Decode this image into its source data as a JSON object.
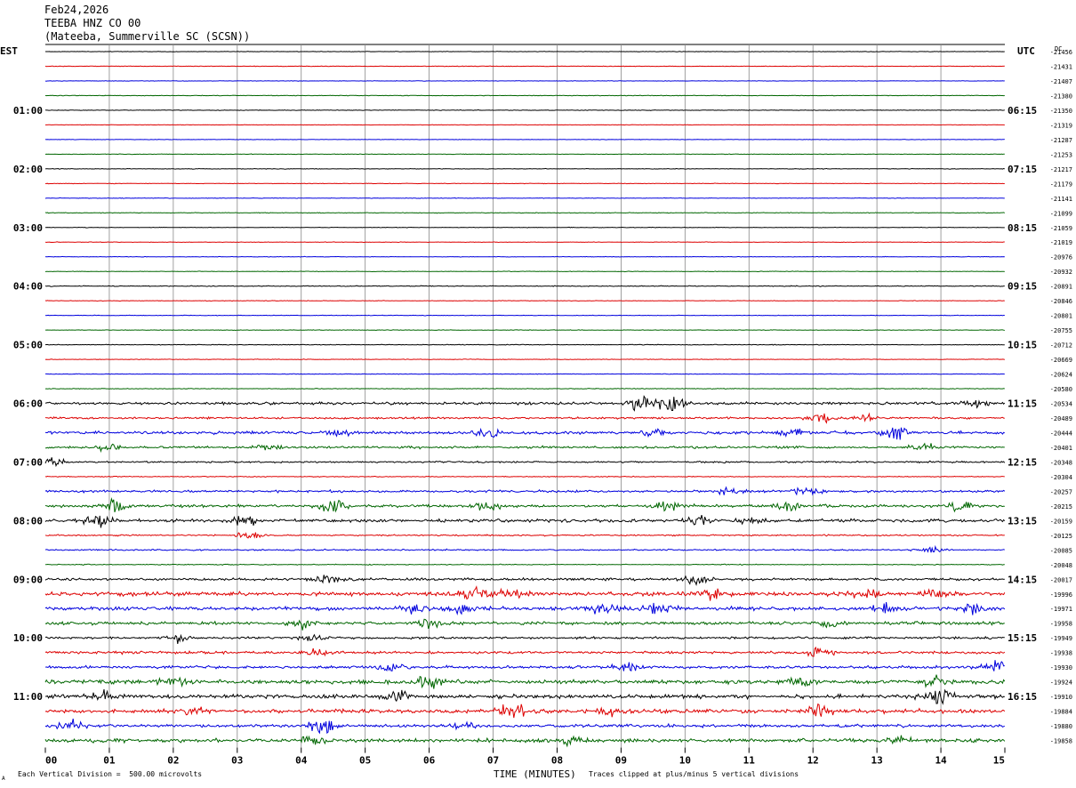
{
  "header": {
    "date": "Feb24,2026",
    "station": "TEEBA HNZ CO 00",
    "location": "(Mateeba, Summerville SC (SCSN))"
  },
  "footer": {
    "scale_note": "Each Vertical Division =  500.00 microvolts",
    "clip_note": "Traces clipped at plus/minus 5 vertical divisions",
    "corner_mark": "A"
  },
  "colors": {
    "cycle": [
      "#000000",
      "#dd0000",
      "#0000dd",
      "#006600"
    ],
    "grid": "#888888"
  },
  "chart_data": {
    "type": "line",
    "subtype": "helicorder",
    "xlabel": "TIME (MINUTES)",
    "x_ticks": [
      "00",
      "01",
      "02",
      "03",
      "04",
      "05",
      "06",
      "07",
      "08",
      "09",
      "10",
      "11",
      "12",
      "13",
      "14",
      "15"
    ],
    "xlim": [
      0,
      15
    ],
    "left_axis_label": "EST",
    "right_axis_label": "UTC",
    "dc_label": "DC",
    "left_hour_labels": [
      "01:00",
      "02:00",
      "03:00",
      "04:00",
      "05:00",
      "06:00",
      "07:00",
      "08:00",
      "09:00",
      "10:00",
      "11:00"
    ],
    "right_hour_labels": [
      "06:15",
      "07:15",
      "08:15",
      "09:15",
      "10:15",
      "11:15",
      "12:15",
      "13:15",
      "14:15",
      "15:15",
      "16:15"
    ],
    "grid": true,
    "rows_per_hour": 4,
    "dc_offsets": [
      -21456,
      -21431,
      -21407,
      -21380,
      -21350,
      -21319,
      -21287,
      -21253,
      -21217,
      -21179,
      -21141,
      -21099,
      -21059,
      -21019,
      -20976,
      -20932,
      -20891,
      -20846,
      -20801,
      -20755,
      -20712,
      -20669,
      -20624,
      -20580,
      -20534,
      -20489,
      -20444,
      -20401,
      -20348,
      -20304,
      -20257,
      -20215,
      -20159,
      -20125,
      -20085,
      -20048,
      -20017,
      -19996,
      -19971,
      -19958,
      -19949,
      -19938,
      -19930,
      -19924,
      -19910,
      -19884,
      -19880,
      -19858
    ],
    "trace_activity": [
      0.15,
      0.2,
      0.15,
      0.2,
      0.2,
      0.15,
      0.15,
      0.2,
      0.2,
      0.2,
      0.2,
      0.25,
      0.2,
      0.2,
      0.2,
      0.2,
      0.3,
      0.2,
      0.2,
      0.2,
      0.25,
      0.2,
      0.2,
      0.25,
      0.9,
      0.7,
      1.0,
      0.8,
      0.6,
      0.3,
      0.8,
      1.0,
      1.1,
      0.5,
      0.5,
      0.3,
      0.9,
      1.4,
      1.3,
      1.1,
      0.8,
      0.9,
      1.0,
      1.4,
      1.4,
      1.4,
      1.0,
      1.3
    ],
    "events": [
      {
        "row": 24,
        "minute": 9.3,
        "amplitude": 2.0
      },
      {
        "row": 24,
        "minute": 9.8,
        "amplitude": 2.6
      },
      {
        "row": 24,
        "minute": 14.5,
        "amplitude": 0.8
      },
      {
        "row": 25,
        "minute": 12.1,
        "amplitude": 1.4
      },
      {
        "row": 25,
        "minute": 12.8,
        "amplitude": 0.8
      },
      {
        "row": 26,
        "minute": 4.6,
        "amplitude": 0.7
      },
      {
        "row": 26,
        "minute": 6.9,
        "amplitude": 1.2
      },
      {
        "row": 26,
        "minute": 9.5,
        "amplitude": 0.9
      },
      {
        "row": 26,
        "minute": 11.7,
        "amplitude": 1.0
      },
      {
        "row": 26,
        "minute": 13.3,
        "amplitude": 1.6
      },
      {
        "row": 27,
        "minute": 1.0,
        "amplitude": 0.8
      },
      {
        "row": 27,
        "minute": 3.5,
        "amplitude": 0.7
      },
      {
        "row": 27,
        "minute": 13.7,
        "amplitude": 1.0
      },
      {
        "row": 28,
        "minute": 0.1,
        "amplitude": 1.0
      },
      {
        "row": 30,
        "minute": 10.7,
        "amplitude": 1.0
      },
      {
        "row": 30,
        "minute": 11.9,
        "amplitude": 1.1
      },
      {
        "row": 31,
        "minute": 1.1,
        "amplitude": 1.6
      },
      {
        "row": 31,
        "minute": 4.5,
        "amplitude": 1.8
      },
      {
        "row": 31,
        "minute": 6.9,
        "amplitude": 1.2
      },
      {
        "row": 31,
        "minute": 9.7,
        "amplitude": 1.4
      },
      {
        "row": 31,
        "minute": 11.6,
        "amplitude": 1.1
      },
      {
        "row": 31,
        "minute": 14.3,
        "amplitude": 1.1
      },
      {
        "row": 32,
        "minute": 0.8,
        "amplitude": 1.6
      },
      {
        "row": 32,
        "minute": 3.1,
        "amplitude": 1.4
      },
      {
        "row": 32,
        "minute": 10.2,
        "amplitude": 1.2
      },
      {
        "row": 32,
        "minute": 11.0,
        "amplitude": 0.8
      },
      {
        "row": 33,
        "minute": 3.2,
        "amplitude": 0.9
      },
      {
        "row": 34,
        "minute": 13.8,
        "amplitude": 0.8
      },
      {
        "row": 36,
        "minute": 4.4,
        "amplitude": 1.1
      },
      {
        "row": 36,
        "minute": 10.2,
        "amplitude": 1.3
      },
      {
        "row": 37,
        "minute": 6.7,
        "amplitude": 2.0
      },
      {
        "row": 37,
        "minute": 7.3,
        "amplitude": 1.1
      },
      {
        "row": 37,
        "minute": 10.4,
        "amplitude": 1.2
      },
      {
        "row": 37,
        "minute": 12.8,
        "amplitude": 1.2
      },
      {
        "row": 37,
        "minute": 13.9,
        "amplitude": 1.5
      },
      {
        "row": 38,
        "minute": 5.8,
        "amplitude": 1.2
      },
      {
        "row": 38,
        "minute": 6.5,
        "amplitude": 1.4
      },
      {
        "row": 38,
        "minute": 8.7,
        "amplitude": 1.4
      },
      {
        "row": 38,
        "minute": 9.6,
        "amplitude": 1.5
      },
      {
        "row": 38,
        "minute": 13.1,
        "amplitude": 1.0
      },
      {
        "row": 38,
        "minute": 14.5,
        "amplitude": 1.0
      },
      {
        "row": 39,
        "minute": 4.0,
        "amplitude": 1.0
      },
      {
        "row": 39,
        "minute": 6.0,
        "amplitude": 1.3
      },
      {
        "row": 39,
        "minute": 12.3,
        "amplitude": 1.0
      },
      {
        "row": 40,
        "minute": 2.1,
        "amplitude": 0.9
      },
      {
        "row": 40,
        "minute": 4.2,
        "amplitude": 0.9
      },
      {
        "row": 41,
        "minute": 4.3,
        "amplitude": 1.0
      },
      {
        "row": 41,
        "minute": 12.1,
        "amplitude": 0.9
      },
      {
        "row": 42,
        "minute": 5.4,
        "amplitude": 0.9
      },
      {
        "row": 42,
        "minute": 9.1,
        "amplitude": 0.8
      },
      {
        "row": 42,
        "minute": 14.9,
        "amplitude": 2.0
      },
      {
        "row": 43,
        "minute": 2.0,
        "amplitude": 1.0
      },
      {
        "row": 43,
        "minute": 6.0,
        "amplitude": 1.2
      },
      {
        "row": 43,
        "minute": 11.8,
        "amplitude": 1.0
      },
      {
        "row": 43,
        "minute": 13.9,
        "amplitude": 1.2
      },
      {
        "row": 44,
        "minute": 0.9,
        "amplitude": 1.0
      },
      {
        "row": 44,
        "minute": 5.5,
        "amplitude": 1.2
      },
      {
        "row": 44,
        "minute": 14.0,
        "amplitude": 1.5
      },
      {
        "row": 45,
        "minute": 2.3,
        "amplitude": 1.2
      },
      {
        "row": 45,
        "minute": 7.3,
        "amplitude": 1.5
      },
      {
        "row": 45,
        "minute": 8.8,
        "amplitude": 1.3
      },
      {
        "row": 45,
        "minute": 12.1,
        "amplitude": 1.3
      },
      {
        "row": 46,
        "minute": 0.4,
        "amplitude": 1.3
      },
      {
        "row": 46,
        "minute": 4.3,
        "amplitude": 2.4
      },
      {
        "row": 46,
        "minute": 6.5,
        "amplitude": 0.8
      },
      {
        "row": 47,
        "minute": 4.2,
        "amplitude": 1.0
      },
      {
        "row": 47,
        "minute": 8.2,
        "amplitude": 1.0
      },
      {
        "row": 47,
        "minute": 13.3,
        "amplitude": 1.2
      }
    ]
  }
}
